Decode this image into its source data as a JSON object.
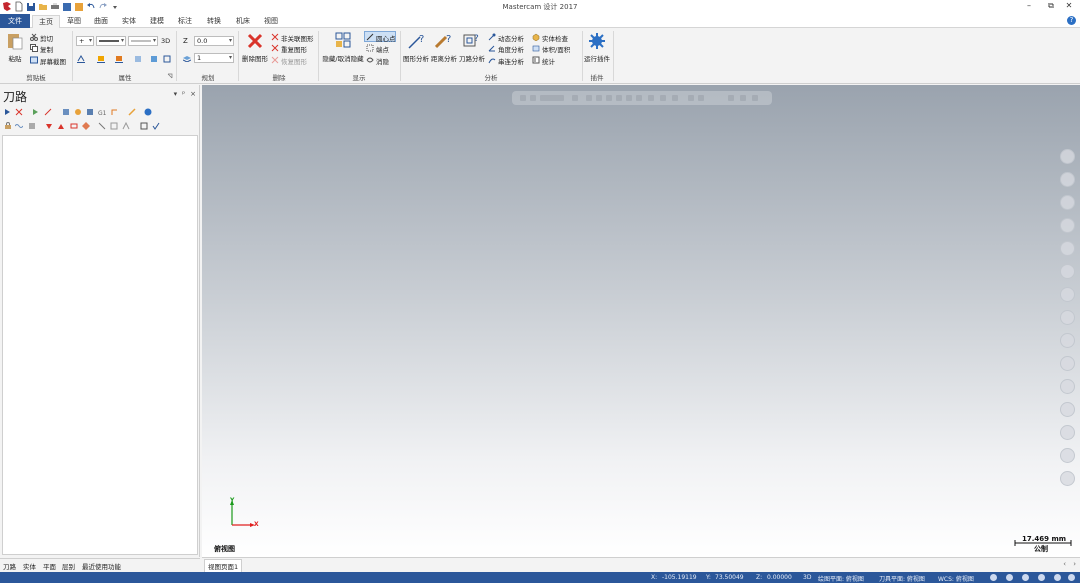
{
  "window": {
    "title": "Mastercam 设计 2017"
  },
  "menu_tabs": [
    "文件",
    "主页",
    "草图",
    "曲面",
    "实体",
    "建模",
    "标注",
    "转换",
    "机床",
    "视图"
  ],
  "ribbon": {
    "clipboard": {
      "label": "剪贴板",
      "paste": "粘贴",
      "cut": "剪切",
      "copy": "复制",
      "screenshot": "屏幕截图"
    },
    "attributes": {
      "label": "属性",
      "three_d": "3D"
    },
    "plan": {
      "label": "规划",
      "z_label": "Z",
      "z_value": "0.0",
      "level_value": "1"
    },
    "delete": {
      "label": "删除",
      "delete_entities": "删除图形",
      "unassoc": "非关联图形",
      "duplicate": "重复图形",
      "undelete": "恢复图形"
    },
    "display": {
      "label": "显示",
      "hide_unhide": "隐藏/取消隐藏",
      "center_point": "圆心点",
      "endpoints": "端点",
      "blank": "消隐"
    },
    "analyze": {
      "label": "分析",
      "entity": "图形分析",
      "distance": "距离分析",
      "toolpath": "刀路分析",
      "dynamic": "动态分析",
      "angle": "角度分析",
      "chain": "串连分析",
      "solid_check": "实体检查",
      "volume": "体积/面积",
      "stats": "统计"
    },
    "addins": {
      "label": "插件",
      "run": "运行插件"
    }
  },
  "left_panel": {
    "title": "刀路",
    "controls": [
      "▾",
      "ᵖ",
      "×"
    ]
  },
  "bottom_tabs": [
    "刀路",
    "实体",
    "平面",
    "层别",
    "最近使用功能"
  ],
  "viewport": {
    "view_name": "俯视图",
    "tab": "视图页面1",
    "scale_value": "17.469 mm",
    "scale_unit": "公制",
    "axis_x": "X",
    "axis_y": "Y"
  },
  "status": {
    "x_label": "X:",
    "x_value": "-105.19119",
    "y_label": "Y:",
    "y_value": "73.50049",
    "z_label": "Z:",
    "z_value": "0.00000",
    "mode": "3D",
    "cplane": "绘图平面: 俯视图",
    "tplane": "刀具平面: 俯视图",
    "wcs": "WCS: 俯视图"
  },
  "colors": {
    "accent": "#2b579a",
    "delete_red": "#d9342b",
    "axis_x": "#e02020",
    "axis_y": "#1a9a1a"
  }
}
